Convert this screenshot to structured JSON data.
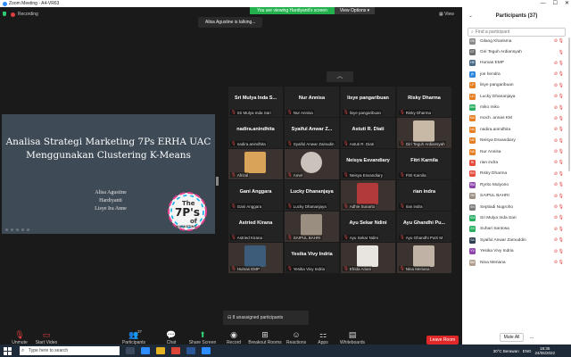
{
  "window": {
    "title": "Zoom Meeting - A4-VR63",
    "controls": [
      "—",
      "☐",
      "✕"
    ]
  },
  "banner": {
    "viewing": "You are viewing Hardiyanti's screen",
    "view_options": "View Options ▾"
  },
  "recording": "Recording",
  "talking": "Alisa Agustine is talking...",
  "view_label": "View",
  "slide": {
    "title_line1": "Analisa Strategi Marketing 7Ps ERHA UAC",
    "title_line2": "Menggunakan Clustering K-Means",
    "authors": [
      "Alisa Agustine",
      "Hardiyanti",
      "Lisye Ira Anne"
    ],
    "logo_line1": "The",
    "logo_line2": "7P's",
    "logo_line3": "of",
    "logo_line4": "MARKETING"
  },
  "grid_up_arrow": "︿",
  "tiles": [
    {
      "big": "Sri Mulya Inda S...",
      "small": "Sri Mulya Inda Sari"
    },
    {
      "big": "Nur Annisa",
      "small": "Nur Annisa"
    },
    {
      "big": "lisye pangaribuan",
      "small": "lisye pangaribuan"
    },
    {
      "big": "Risky Dharma",
      "small": "Risky Dharma"
    },
    {
      "big": "nadira.anindhita",
      "small": "nadira.anindhita"
    },
    {
      "big": "Syaiful Anwar Z...",
      "small": "Syaiful Anwar Zainudin"
    },
    {
      "big": "Astuti R. Diati",
      "small": "Astuti R. Diati"
    },
    {
      "big": "",
      "small": "Giri Teguh Ardiansyah",
      "photo": "#c8b8a6"
    },
    {
      "big": "",
      "small": "Afrizal",
      "photo": "#d9a45a"
    },
    {
      "big": "",
      "small": "Amel",
      "photo": "#c9c3bb"
    },
    {
      "big": "Neisya Esvandiary",
      "small": "Neisya Esvandiary"
    },
    {
      "big": "Fitri Karnila",
      "small": "Fitri Karnila"
    },
    {
      "big": "Gani Anggara",
      "small": "Gani Anggara"
    },
    {
      "big": "Lucky Dhananjaya",
      "small": "Lucky Dhananjaya"
    },
    {
      "big": "",
      "small": "Adhie Sunarto",
      "photo": "#b23a3a"
    },
    {
      "big": "rian indra",
      "small": "rian indra"
    },
    {
      "big": "Astried Kirana",
      "small": "Astried Kirana"
    },
    {
      "big": "",
      "small": "SAIPUL BAHRI",
      "photo": "#9a8e80"
    },
    {
      "big": "Ayu Sekar Ndini",
      "small": "Ayu Sekar Ndini"
    },
    {
      "big": "Ayu Ghandhi Pu...",
      "small": "Ayu Ghandhi Putri M"
    },
    {
      "big": "",
      "small": "Humas EMP",
      "photo": "#3d5c7a"
    },
    {
      "big": "Yesika Vivy Indria",
      "small": "Yesika Vivy Indria"
    },
    {
      "big": "",
      "small": "Efrida Ariani",
      "photo": "#e8e4df"
    },
    {
      "big": "",
      "small": "Nina Meriana",
      "photo": "#c0b2a4"
    }
  ],
  "unassigned": "8 unassigned participants",
  "toolbar": {
    "unmute": "Unmute",
    "start_video": "Start Video",
    "participants": "Participants",
    "participants_count": "37",
    "chat": "Chat",
    "share_screen": "Share Screen",
    "record": "Record",
    "breakout": "Breakout Rooms",
    "reactions": "Reactions",
    "apps": "Apps",
    "whiteboards": "Whiteboards",
    "leave": "Leave Room"
  },
  "panel": {
    "title": "Participants (37)",
    "find_placeholder": "Find a participant",
    "mute_all": "Mute All",
    "more": "..."
  },
  "participants": [
    {
      "name": "Gilang Kharisma",
      "initials": "GK",
      "color": "#8a8a8a",
      "cam": true
    },
    {
      "name": "Giri Teguh Ardiansyah",
      "initials": "GT",
      "color": "#6c6c6c",
      "cam": false
    },
    {
      "name": "Humas EMP",
      "initials": "HE",
      "color": "#4a6a88",
      "cam": true
    },
    {
      "name": "joe hendra",
      "initials": "jh",
      "color": "#2e86de",
      "cam": true
    },
    {
      "name": "lisye pangaribuan",
      "initials": "LP",
      "color": "#e67e22",
      "cam": true
    },
    {
      "name": "Lucky Dhananjaya",
      "initials": "LD",
      "color": "#e67e22",
      "cam": true
    },
    {
      "name": "miko miko",
      "initials": "MM",
      "color": "#27ae60",
      "cam": true
    },
    {
      "name": "moch. annas KM",
      "initials": "MA",
      "color": "#e67e22",
      "cam": true
    },
    {
      "name": "nadira.anindhita",
      "initials": "NA",
      "color": "#e67e22",
      "cam": true
    },
    {
      "name": "Neisya Esvandiary",
      "initials": "NE",
      "color": "#e67e22",
      "cam": true
    },
    {
      "name": "Nur Annisa",
      "initials": "NA",
      "color": "#e67e22",
      "cam": true
    },
    {
      "name": "rian indra",
      "initials": "RI",
      "color": "#e74c3c",
      "cam": true
    },
    {
      "name": "Risky Dharma",
      "initials": "RD",
      "color": "#e74c3c",
      "cam": true
    },
    {
      "name": "Ryrito Mulyono",
      "initials": "RM",
      "color": "#8e44ad",
      "cam": true
    },
    {
      "name": "SAIPUL BAHRI",
      "initials": "SB",
      "color": "#9a8e80",
      "cam": true
    },
    {
      "name": "Septiadi Nugroho",
      "initials": "SN",
      "color": "#7a7a7a",
      "cam": true
    },
    {
      "name": "Sri Mulya Inda Sari",
      "initials": "SM",
      "color": "#27ae60",
      "cam": true
    },
    {
      "name": "Suhari Santosa",
      "initials": "SS",
      "color": "#27ae60",
      "cam": true
    },
    {
      "name": "Syaiful Anwar Zamuddin",
      "initials": "SA",
      "color": "#2c3e50",
      "cam": true
    },
    {
      "name": "Yesika Vivy Indria",
      "initials": "YV",
      "color": "#8e44ad",
      "cam": true
    },
    {
      "name": "Nina Meriana",
      "initials": "NM",
      "color": "#b0a090",
      "cam": true
    }
  ],
  "taskbar": {
    "search_placeholder": "Type here to search",
    "weather": "30°C Berawan",
    "lang": "ENG",
    "time": "18:35",
    "date": "24/05/2022"
  }
}
